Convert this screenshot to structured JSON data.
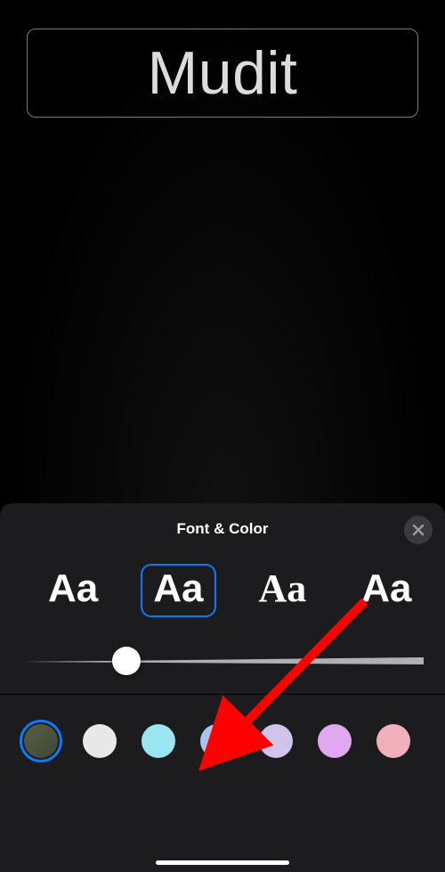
{
  "canvas": {
    "main_text": "Mudit"
  },
  "sheet": {
    "title": "Font & Color",
    "fonts": [
      {
        "label": "Aa",
        "selected": false
      },
      {
        "label": "Aa",
        "selected": true
      },
      {
        "label": "Aa",
        "selected": false
      },
      {
        "label": "Aa",
        "selected": false
      }
    ],
    "slider": {
      "value_percent": 26
    },
    "colors": [
      {
        "name": "olive-dark",
        "hex_gradient": "linear-gradient(135deg,#5b6146,#3e4534)",
        "selected": true
      },
      {
        "name": "white",
        "hex": "#e8e8e8",
        "selected": false
      },
      {
        "name": "light-cyan",
        "hex": "#99e6f2",
        "selected": false
      },
      {
        "name": "light-blue",
        "hex": "#a8c4f0",
        "selected": false
      },
      {
        "name": "lavender",
        "hex": "#d0c4ed",
        "selected": false
      },
      {
        "name": "light-purple",
        "hex": "#dfa8f0",
        "selected": false
      },
      {
        "name": "light-pink",
        "hex": "#f2b0bc",
        "selected": false
      }
    ]
  }
}
